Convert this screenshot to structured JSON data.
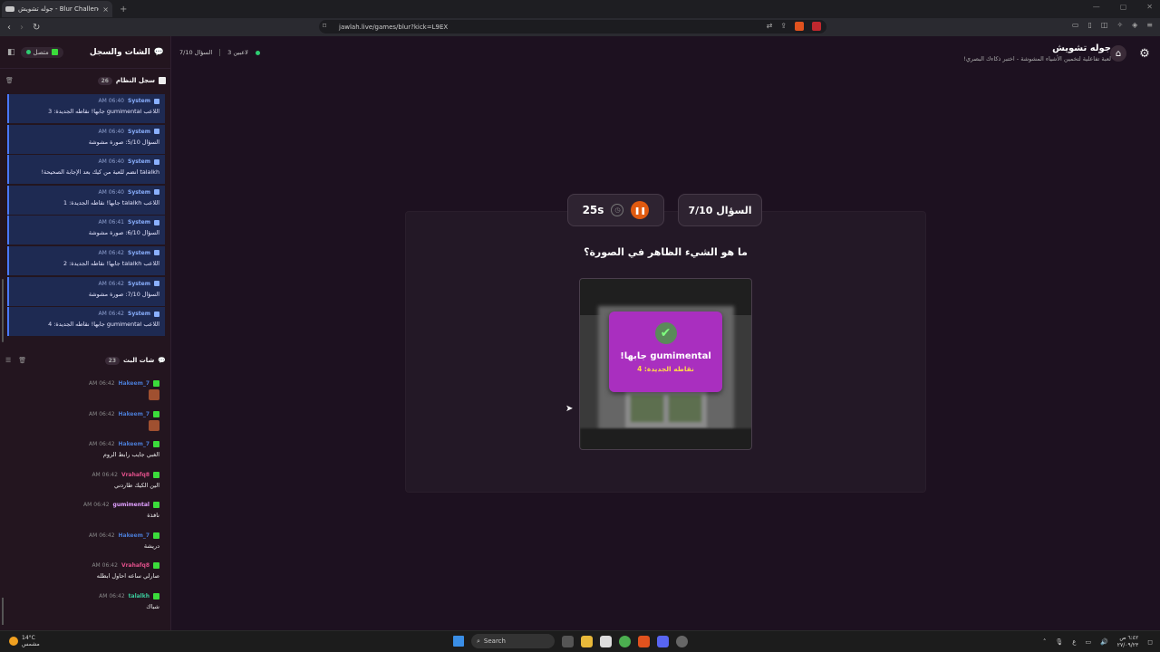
{
  "browser": {
    "tab_title": "جوله تشويش - Blur Challenge |",
    "tab_close": "×",
    "new_tab": "+",
    "url": "jawlah.live/games/blur?kick=L9EX",
    "win_min": "—",
    "win_max": "▢",
    "win_close": "✕"
  },
  "sidebar": {
    "title": "الشات والسجل",
    "connection_status": "متصل",
    "system_log": {
      "title": "سجل النظام",
      "count": "26",
      "messages": [
        {
          "sender": "System",
          "time": "06:40 AM",
          "text": "اللاعب gumimental جابها! نقاطه الجديدة: 3"
        },
        {
          "sender": "System",
          "time": "06:40 AM",
          "text": "السؤال 5/10: صورة مشوشة"
        },
        {
          "sender": "System",
          "time": "06:40 AM",
          "text": "talalkh انضم للعبة من كيك بعد الإجابة الصحيحة!"
        },
        {
          "sender": "System",
          "time": "06:40 AM",
          "text": "اللاعب talalkh جابها! نقاطه الجديدة: 1"
        },
        {
          "sender": "System",
          "time": "06:41 AM",
          "text": "السؤال 6/10: صورة مشوشة"
        },
        {
          "sender": "System",
          "time": "06:42 AM",
          "text": "اللاعب talalkh جابها! نقاطه الجديدة: 2"
        },
        {
          "sender": "System",
          "time": "06:42 AM",
          "text": "السؤال 7/10: صورة مشوشة"
        },
        {
          "sender": "System",
          "time": "06:42 AM",
          "text": "اللاعب gumimental جابها! نقاطه الجديدة: 4"
        }
      ]
    },
    "live_chat": {
      "title": "شات البث",
      "count": "23",
      "messages": [
        {
          "user": "Hakeem_7",
          "color": "#4a7bd4",
          "time": "06:42 AM",
          "text": "",
          "emote": true
        },
        {
          "user": "Hakeem_7",
          "color": "#4a7bd4",
          "time": "06:42 AM",
          "text": "",
          "emote": true
        },
        {
          "user": "Hakeem_7",
          "color": "#4a7bd4",
          "time": "06:42 AM",
          "text": "الغبي جايب رابط الروم",
          "emote": false
        },
        {
          "user": "Vrahafq8",
          "color": "#e0508a",
          "time": "06:42 AM",
          "text": "الين الكيك طاردني",
          "emote": false
        },
        {
          "user": "gumimental",
          "color": "#e0a0ff",
          "time": "06:42 AM",
          "text": "نافذة",
          "emote": false
        },
        {
          "user": "Hakeem_7",
          "color": "#4a7bd4",
          "time": "06:42 AM",
          "text": "دريشة",
          "emote": false
        },
        {
          "user": "Vrahafq8",
          "color": "#e0508a",
          "time": "06:42 AM",
          "text": "صارلي ساعه احاول ابطله",
          "emote": false
        },
        {
          "user": "talalkh",
          "color": "#3ac89a",
          "time": "06:42 AM",
          "text": "شباك",
          "emote": false
        }
      ]
    }
  },
  "main": {
    "players": "3 لاعبين",
    "question_counter": "السؤال 7/10",
    "brand_title": "جوله تشويش",
    "brand_subtitle": "لعبة تفاعلية لتخمين الأشياء المشوشة - اختبر ذكاءك البصري!",
    "question_pill": "السؤال 7/10",
    "timer": "25s",
    "question": "ما هو الشيء الظاهر في الصورة؟",
    "popup": {
      "title": "gumimental جابها!",
      "subtitle": "نقاطه الجديدة: 4"
    }
  },
  "taskbar": {
    "temp": "14°C",
    "weather": "مشمس",
    "search": "Search",
    "lang": "ع",
    "time": "٦:٤٢ ص",
    "date": "٢٧/٠٩/٢٣"
  }
}
